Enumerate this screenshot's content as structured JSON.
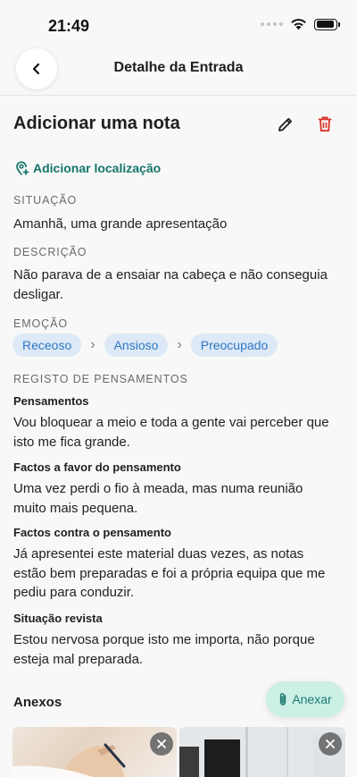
{
  "status_bar": {
    "time": "21:49"
  },
  "nav": {
    "title": "Detalhe da Entrada",
    "back_icon": "chevron-left-icon"
  },
  "entry": {
    "title": "Adicionar uma nota"
  },
  "location": {
    "label": "Adicionar localização"
  },
  "situation": {
    "label": "SITUAÇÃO",
    "text": "Amanhã, uma grande apresentação"
  },
  "description": {
    "label": "DESCRIÇÃO",
    "text": "Não parava de a ensaiar na cabeça e não conseguia desligar."
  },
  "emotion": {
    "label": "EMOÇÃO",
    "chips": [
      "Receoso",
      "Ansioso",
      "Preocupado"
    ]
  },
  "thoughts": {
    "label": "REGISTO DE PENSAMENTOS",
    "items": [
      {
        "title": "Pensamentos",
        "text": "Vou bloquear a meio e toda a gente vai perceber que isto me fica grande."
      },
      {
        "title": "Factos a favor do pensamento",
        "text": "Uma vez perdi o fio à meada, mas numa reunião muito mais pequena."
      },
      {
        "title": "Factos contra o pensamento",
        "text": "Já apresentei este material duas vezes, as notas estão bem preparadas e foi a própria equipa que me pediu para conduzir."
      },
      {
        "title": "Situação revista",
        "text": "Estou nervosa porque isto me importa, não porque esteja mal preparada."
      }
    ]
  },
  "attachments": {
    "title": "Anexos",
    "attach_label": "Anexar"
  },
  "colors": {
    "accent_green": "#14766a",
    "delete_red": "#d93025",
    "chip_bg": "#dde9f6",
    "chip_text": "#2f76c6",
    "attach_bg": "#cdf0e6"
  }
}
